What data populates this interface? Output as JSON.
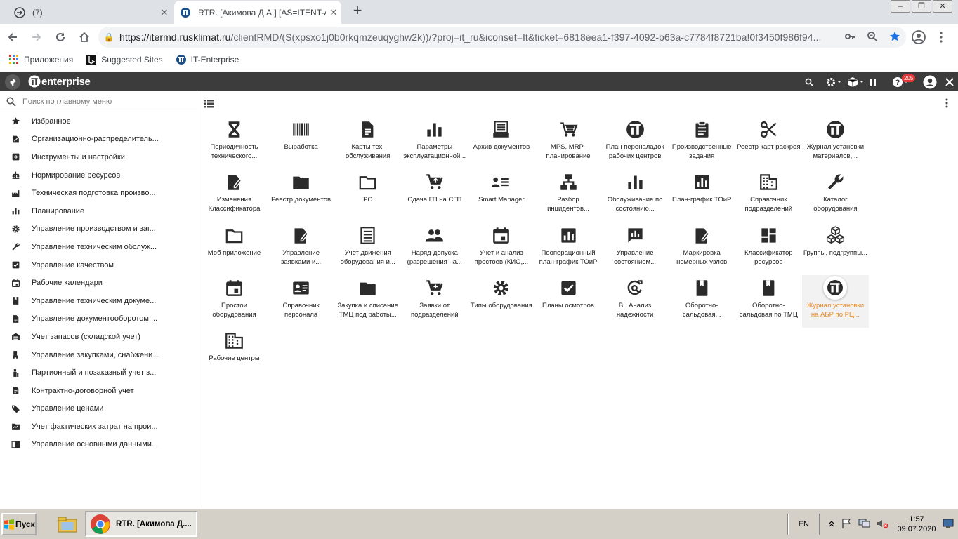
{
  "browser": {
    "tabs": [
      {
        "title": "(7)"
      },
      {
        "title": "RTR. [Акимова Д.А.] [AS=ITENT-AI"
      }
    ],
    "new_tab_label": "+",
    "url_host": "https://itermd.rusklimat.ru",
    "url_rest": "/clientRMD/(S(xpsxo1j0b0rkqmzeuqyghw2k))/?proj=it_ru&iconset=It&ticket=6818eea1-f397-4092-b63a-c7784f8721ba!0f3450f986f94...",
    "bookmarks": [
      {
        "label": "Приложения",
        "icon": "apps-grid-icon"
      },
      {
        "label": "Suggested Sites",
        "icon": "bing-icon"
      },
      {
        "label": "IT-Enterprise",
        "icon": "it-enterprise-icon"
      }
    ]
  },
  "app": {
    "logo_text": "enterprise",
    "notifications_count": "205"
  },
  "sidebar": {
    "search_placeholder": "Поиск по главному меню",
    "items": [
      {
        "label": "Избранное",
        "icon": "star-icon"
      },
      {
        "label": "Организационно-распределитель...",
        "icon": "org-icon"
      },
      {
        "label": "Инструменты и настройки",
        "icon": "tools-settings-icon"
      },
      {
        "label": "Нормирование ресурсов",
        "icon": "scale-icon"
      },
      {
        "label": "Техническая подготовка произво...",
        "icon": "factory-icon"
      },
      {
        "label": "Планирование",
        "icon": "bar-chart-icon"
      },
      {
        "label": "Управление производством и заг...",
        "icon": "gear-icon"
      },
      {
        "label": "Управление техническим обслуж...",
        "icon": "wrench-icon"
      },
      {
        "label": "Управление качеством",
        "icon": "checkbox-icon"
      },
      {
        "label": "Рабочие календари",
        "icon": "calendar-icon"
      },
      {
        "label": "Управление техническим докуме...",
        "icon": "book-icon"
      },
      {
        "label": "Управление документооборотом ...",
        "icon": "document-icon"
      },
      {
        "label": "Учет запасов (складской учет)",
        "icon": "warehouse-icon"
      },
      {
        "label": "Управление закупками, снабжени...",
        "icon": "truck-icon"
      },
      {
        "label": "Партионный и позаказный учет з...",
        "icon": "batch-icon"
      },
      {
        "label": "Контрактно-договорной учет",
        "icon": "contract-icon"
      },
      {
        "label": "Управление ценами",
        "icon": "price-tag-icon"
      },
      {
        "label": "Учет фактических затрат на прои...",
        "icon": "folder-cost-icon"
      },
      {
        "label": "Управление основными данными...",
        "icon": "master-data-icon"
      }
    ]
  },
  "main": {
    "tiles": [
      {
        "label": "Периодичность технического...",
        "icon": "hourglass-icon"
      },
      {
        "label": "Выработка",
        "icon": "barcode-icon"
      },
      {
        "label": "Карты тех. обслуживания",
        "icon": "document-icon"
      },
      {
        "label": "Параметры эксплуатационной...",
        "icon": "bar-chart-icon"
      },
      {
        "label": "Архив документов",
        "icon": "archive-icon"
      },
      {
        "label": "MPS, MRP-планирование",
        "icon": "cart-list-icon"
      },
      {
        "label": "План переналадок рабочих центров",
        "icon": "it-logo-icon"
      },
      {
        "label": "Производственные задания",
        "icon": "clipboard-icon"
      },
      {
        "label": "Реестр карт раскроя",
        "icon": "scissors-icon"
      },
      {
        "label": "Журнал установки материалов,...",
        "icon": "it-logo-icon"
      },
      {
        "label": "Изменения Классификатора",
        "icon": "edit-doc-icon"
      },
      {
        "label": "Реестр документов",
        "icon": "folder-icon"
      },
      {
        "label": "PC",
        "icon": "folder-outline-icon"
      },
      {
        "label": "Сдача ГП на СГП",
        "icon": "cart-up-icon"
      },
      {
        "label": "Smart Manager",
        "icon": "list-person-icon"
      },
      {
        "label": "Разбор инцидентов...",
        "icon": "hierarchy-icon"
      },
      {
        "label": "Обслуживание по состоянию...",
        "icon": "bar-chart-icon"
      },
      {
        "label": "План-график ТОиР",
        "icon": "chart-box-icon"
      },
      {
        "label": "Справочник подразделений",
        "icon": "building-icon"
      },
      {
        "label": "Каталог оборудования",
        "icon": "wrench-icon"
      },
      {
        "label": "Моб приложение",
        "icon": "folder-outline-icon"
      },
      {
        "label": "Управление заявками и...",
        "icon": "edit-doc-icon"
      },
      {
        "label": "Учет движения оборудования и...",
        "icon": "list-doc-icon"
      },
      {
        "label": "Наряд-допуска (разрешения на...",
        "icon": "people-icon"
      },
      {
        "label": "Учет и анализ простоев (КИО,...",
        "icon": "calendar-event-icon"
      },
      {
        "label": "Пооперационный план-график ТОиР",
        "icon": "chart-box-icon"
      },
      {
        "label": "Управление состоянием...",
        "icon": "feedback-chart-icon"
      },
      {
        "label": "Маркировка номерных узлов",
        "icon": "edit-doc-icon"
      },
      {
        "label": "Классификатор ресурсов",
        "icon": "dashboard-icon"
      },
      {
        "label": "Группы, подгруппы...",
        "icon": "cubes-icon"
      },
      {
        "label": "Простои оборудования",
        "icon": "calendar-event-icon"
      },
      {
        "label": "Справочник персонала",
        "icon": "id-card-icon"
      },
      {
        "label": "Закупка и списание ТМЦ под работы...",
        "icon": "folder-icon"
      },
      {
        "label": "Заявки от подразделений",
        "icon": "cart-add-icon"
      },
      {
        "label": "Типы оборудования",
        "icon": "gear-icon"
      },
      {
        "label": "Планы осмотров",
        "icon": "checkbox-icon"
      },
      {
        "label": "BI. Анализ надежности",
        "icon": "refresh-search-icon"
      },
      {
        "label": "Оборотно-сальдовая...",
        "icon": "book-icon"
      },
      {
        "label": "Оборотно-сальдовая по ТМЦ",
        "icon": "book-icon"
      },
      {
        "label": "Журнал установки на АБР по РЦ...",
        "icon": "it-logo-icon"
      },
      {
        "label": "Рабочие центры",
        "icon": "building-icon"
      }
    ]
  },
  "taskbar": {
    "start_label": "Пуск",
    "task_label": "RTR. [Акимова Д....",
    "lang": "EN",
    "time": "1:57",
    "date": "09.07.2020"
  }
}
